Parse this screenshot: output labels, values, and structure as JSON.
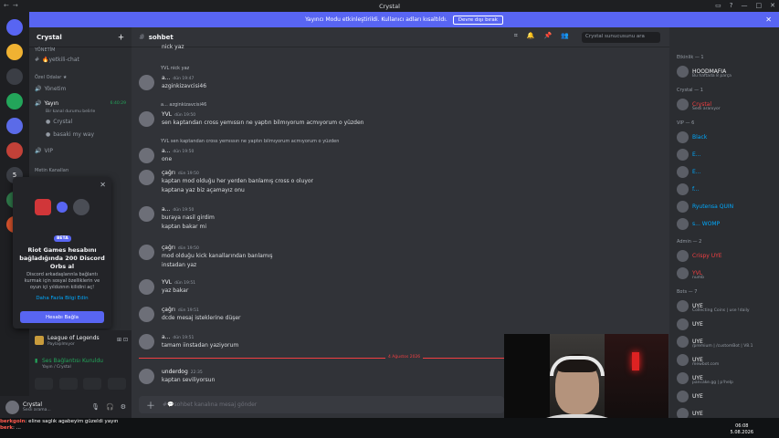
{
  "window": {
    "title": "Crystal"
  },
  "banner": {
    "text": "Yayıncı Modu etkinleştirildi. Kullanıcı adları kısaltıldı.",
    "button": "Devre dışı bırak"
  },
  "servers": [
    {
      "label": "",
      "badge": "606"
    },
    {
      "label": "",
      "badge": "1"
    },
    {
      "label": "",
      "badge": ""
    },
    {
      "label": "",
      "badge": ""
    },
    {
      "label": "",
      "badge": ""
    },
    {
      "label": "",
      "badge": ""
    },
    {
      "label": "5",
      "badge": ""
    },
    {
      "label": "",
      "badge": "36"
    },
    {
      "label": "",
      "badge": "1"
    }
  ],
  "sidebar": {
    "server_name": "Crystal",
    "channels": [
      {
        "label": "YÖNETİM",
        "type": "category"
      },
      {
        "label": "🔥yetkili-chat",
        "type": "text"
      },
      {
        "label": "Özel Odalar ★",
        "type": "category"
      },
      {
        "label": "Yönetim",
        "type": "voice"
      },
      {
        "label": "Yayın",
        "type": "voice"
      },
      {
        "label": "Bir kanal durumu belirle",
        "type": "sub"
      },
      {
        "label": "Crystal",
        "type": "user"
      },
      {
        "label": "basaki my way",
        "type": "user"
      },
      {
        "label": "VIP",
        "type": "voice"
      },
      {
        "label": "Metin Kanalları",
        "type": "category"
      }
    ],
    "live_time": "6:40:29"
  },
  "popup": {
    "beta": "BETA",
    "title": "Riot Games hesabını bağladığında 200 Discord Orbs al",
    "desc": "Discord arkadaşlarınla bağlantı kurmak için sosyal özelliklerin ve oyun içi yıldızının kilidini aç!",
    "link": "Daha Fazla Bilgi Edin",
    "button": "Hesabı Bağla"
  },
  "activity": {
    "game": "League of Legends",
    "game_sub": "Paylaşılmıyor",
    "voice_status": "Ses Bağlantısı Kuruldu",
    "voice_sub": "Yayın / Crystal"
  },
  "user": {
    "name": "Crystal",
    "status": "Sesli arama..."
  },
  "channel": {
    "name": "sohbet",
    "search_placeholder": "Crystal sunucusunu ara",
    "composer_placeholder": "#💬sohbet kanalına mesaj gönder"
  },
  "messages": [
    {
      "reply": "",
      "user": "",
      "time": "",
      "text": "nick yaz",
      "line2": ""
    },
    {
      "reply": "YVL  nick yaz",
      "user": "a...",
      "time": "dün 19:47",
      "text": "azginkizavcisi46",
      "line2": ""
    },
    {
      "reply": "a... azginkizavcisi46",
      "user": "YVL",
      "time": "dün 19:50",
      "text": "sen kaptandan cross yemıssın ne yaptın bilmıyorum acmıyorum o yüzden",
      "line2": ""
    },
    {
      "reply": "YVL  sen kaptandan cross yemıssın ne yaptın bilmıyorum acmıyorum o yüzden",
      "user": "a...",
      "time": "dün 19:50",
      "text": "one",
      "line2": ""
    },
    {
      "reply": "",
      "user": "çağrı",
      "time": "dün 19:50",
      "text": "kaptan mod olduğu her yerden banlamış cross o oluyor",
      "line2": "kaptana yaz biz açamayız onu"
    },
    {
      "reply": "",
      "user": "a...",
      "time": "dün 19:50",
      "text": "buraya nasil girdim",
      "line2": "kaptan bakar mi"
    },
    {
      "reply": "",
      "user": "çağrı",
      "time": "dün 19:50",
      "text": "mod olduğu kick kanallarından banlamış",
      "line2": "instadan yaz"
    },
    {
      "reply": "",
      "user": "YVL",
      "time": "dün 19:51",
      "text": "yaz bakar",
      "line2": ""
    },
    {
      "reply": "",
      "user": "çağrı",
      "time": "dün 19:51",
      "text": "dcde mesaj isteklerine düşer",
      "line2": ""
    },
    {
      "reply": "",
      "user": "a...",
      "time": "dün 19:51",
      "text": "tamam iinstadan yaziyorum",
      "line2": ""
    },
    {
      "reply": "",
      "user": "underdog",
      "time": "22:35",
      "text": "kaptan seviliyorsun",
      "line2": ""
    }
  ],
  "date_divider": "4 Ağustos 2026",
  "members": {
    "sections": [
      {
        "title": "Etkinlik — 1",
        "items": [
          {
            "name": "HOODMAFIA",
            "sub": "Bu haftada 8 parça",
            "color": "#f2f3f5"
          }
        ]
      },
      {
        "title": "Crystal — 1",
        "items": [
          {
            "name": "Crystal",
            "sub": "Sesli aranıyor",
            "color": "#f23f42"
          }
        ]
      },
      {
        "title": "VIP — 6",
        "items": [
          {
            "name": "Black",
            "sub": "",
            "color": "#00a8fc"
          },
          {
            "name": "E...",
            "sub": "",
            "color": "#00a8fc"
          },
          {
            "name": "E...",
            "sub": "",
            "color": "#00a8fc"
          },
          {
            "name": "f...",
            "sub": "",
            "color": "#00a8fc"
          },
          {
            "name": "Ryutensa  QUIN",
            "sub": "",
            "color": "#00a8fc"
          },
          {
            "name": "s...  WOMP",
            "sub": "",
            "color": "#00a8fc"
          }
        ]
      },
      {
        "title": "Admin — 2",
        "items": [
          {
            "name": "Crispy  UYE",
            "sub": "",
            "color": "#f23f42"
          },
          {
            "name": "YVL",
            "sub": "numb",
            "color": "#f23f42"
          }
        ]
      },
      {
        "title": "Bots — 7",
        "items": [
          {
            "name": "UYE",
            "sub": "Collecting Coins | use !daily",
            "color": "#f2f3f5"
          },
          {
            "name": "UYE",
            "sub": "",
            "color": "#f2f3f5"
          },
          {
            "name": "UYE",
            "sub": "/premium | /customBot | V8.1",
            "color": "#f2f3f5"
          },
          {
            "name": "UYE",
            "sub": "mewbot.com",
            "color": "#f2f3f5"
          },
          {
            "name": "UYE",
            "sub": "pancake.gg | p!help",
            "color": "#f2f3f5"
          },
          {
            "name": "UYE",
            "sub": "",
            "color": "#f2f3f5"
          },
          {
            "name": "UYE",
            "sub": "",
            "color": "#f2f3f5"
          }
        ]
      }
    ]
  },
  "overlay_chat": [
    {
      "user": "berkgoin",
      "text": ": eline saglık agabeyim güzeldi yayın"
    },
    {
      "user": "berk",
      "text": ": ..."
    }
  ],
  "clock": {
    "time": "06:08",
    "date": "5.08.2026"
  },
  "colors": {
    "accent": "#5865f2",
    "danger": "#f23f42",
    "bg_main": "#313338",
    "bg_side": "#2b2d31"
  }
}
